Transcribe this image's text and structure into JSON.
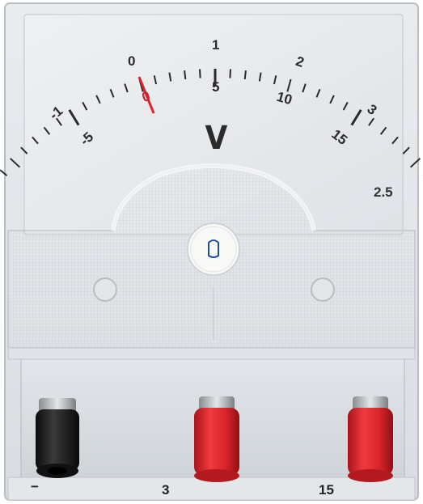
{
  "meter": {
    "unit": "V",
    "accuracy_class": "2.5",
    "upper_scale_labels": [
      "-1",
      "0",
      "1",
      "2",
      "3"
    ],
    "lower_scale_labels": [
      "-5",
      "0",
      "5",
      "10",
      "15"
    ],
    "needle_reading": "0",
    "terminals": [
      {
        "label": "−",
        "color": "#1f1f1f"
      },
      {
        "label": "3",
        "color": "#d8242a"
      },
      {
        "label": "15",
        "color": "#d8242a"
      }
    ],
    "adjuster_label": "Adjuster"
  }
}
